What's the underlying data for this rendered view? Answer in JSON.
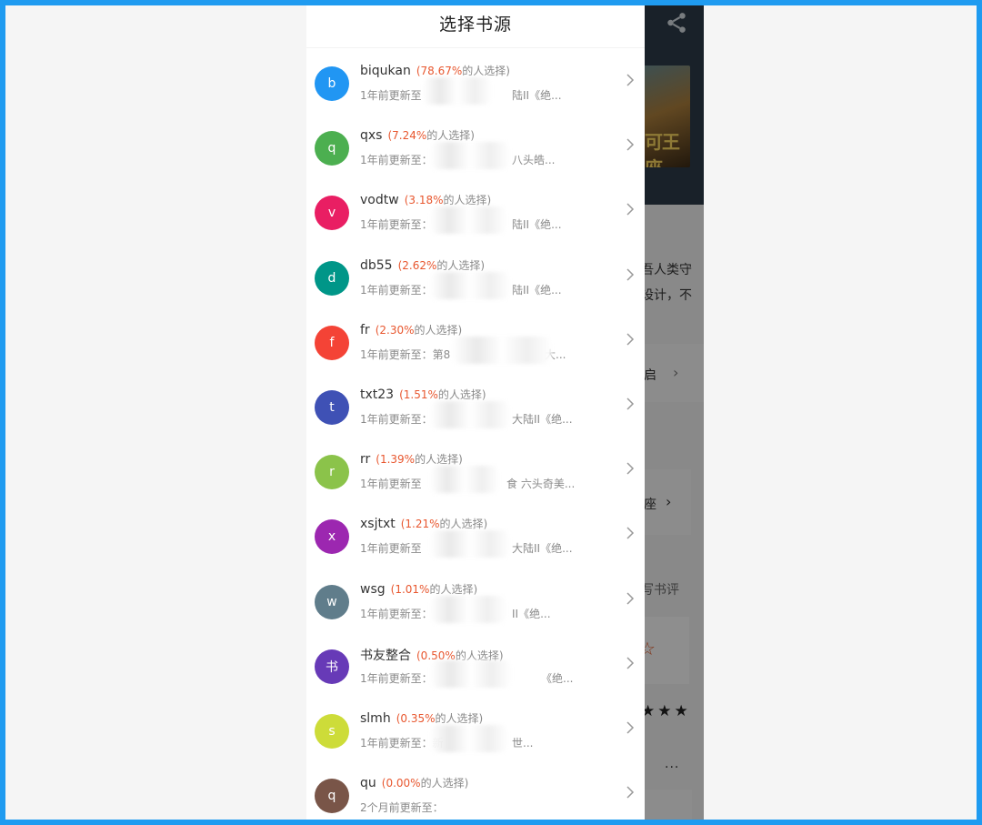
{
  "drawer": {
    "title": "选择书源"
  },
  "background": {
    "cover_text": "可王座",
    "line1": "吾人类守",
    "line2": "设计，不",
    "row_text": "启",
    "link_text": "王座",
    "review_text": "写书评",
    "stars": "★★★",
    "outline_star": "☆",
    "more": "···"
  },
  "sources": [
    {
      "letter": "b",
      "color": "#2196f3",
      "name": "biqukan",
      "pct": "(78.67%",
      "suffix": "的人选择)",
      "update": "1年前更新至",
      "tail": "陆II《绝..."
    },
    {
      "letter": "q",
      "color": "#4caf50",
      "name": "qxs",
      "pct": "(7.24%",
      "suffix": "的人选择)",
      "update": "1年前更新至：",
      "tail": "八头皓..."
    },
    {
      "letter": "v",
      "color": "#e91e63",
      "name": "vodtw",
      "pct": "(3.18%",
      "suffix": "的人选择)",
      "update": "1年前更新至：",
      "tail": "陆II《绝..."
    },
    {
      "letter": "d",
      "color": "#009688",
      "name": "db55",
      "pct": "(2.62%",
      "suffix": "的人选择)",
      "update": "1年前更新至：",
      "tail": "陆II《绝..."
    },
    {
      "letter": "f",
      "color": "#f44336",
      "name": "fr",
      "pct": "(2.30%",
      "suffix": "的人选择)",
      "update": "1年前更新至：第8",
      "tail": "大..."
    },
    {
      "letter": "t",
      "color": "#3f51b5",
      "name": "txt23",
      "pct": "(1.51%",
      "suffix": "的人选择)",
      "update": "1年前更新至：",
      "tail": "大陆II《绝..."
    },
    {
      "letter": "r",
      "color": "#8bc34a",
      "name": "rr",
      "pct": "(1.39%",
      "suffix": "的人选择)",
      "update": "1年前更新至",
      "tail": "食 六头奇美..."
    },
    {
      "letter": "x",
      "color": "#9c27b0",
      "name": "xsjtxt",
      "pct": "(1.21%",
      "suffix": "的人选择)",
      "update": "1年前更新至",
      "tail": "大陆II《绝..."
    },
    {
      "letter": "w",
      "color": "#607d8b",
      "name": "wsg",
      "pct": "(1.01%",
      "suffix": "的人选择)",
      "update": "1年前更新至：",
      "tail": "II《绝..."
    },
    {
      "letter": "书",
      "color": "#673ab7",
      "name": "书友整合",
      "pct": "(0.50%",
      "suffix": "的人选择)",
      "update": "1年前更新至：",
      "tail": "《绝..."
    },
    {
      "letter": "s",
      "color": "#cddc39",
      "name": "slmh",
      "pct": "(0.35%",
      "suffix": "的人选择)",
      "update": "1年前更新至：新",
      "tail": "世..."
    },
    {
      "letter": "q",
      "color": "#795548",
      "name": "qu",
      "pct": "(0.00%",
      "suffix": "的人选择)",
      "update": "2个月前更新至：",
      "tail": ""
    }
  ]
}
